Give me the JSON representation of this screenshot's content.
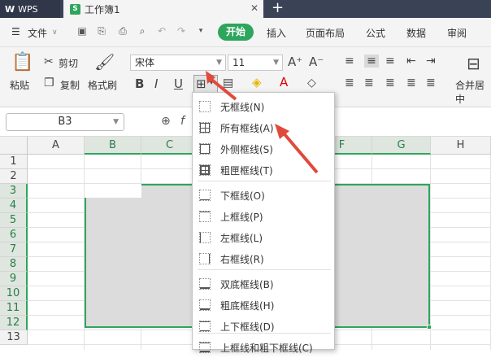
{
  "titlebar": {
    "app_tab": "WPS",
    "doc_tab": "工作簿1",
    "doc_icon": "S"
  },
  "menubar": {
    "file": "文件",
    "tabs": [
      "开始",
      "插入",
      "页面布局",
      "公式",
      "数据",
      "审阅"
    ]
  },
  "ribbon": {
    "paste": "粘贴",
    "cut": "剪切",
    "copy": "复制",
    "format_painter": "格式刷",
    "font_name": "宋体",
    "font_size": "11",
    "merge_center": "合并居中"
  },
  "formula_bar": {
    "name_box": "B3"
  },
  "grid": {
    "columns": [
      "A",
      "B",
      "C",
      "D",
      "E",
      "F",
      "G",
      "H"
    ],
    "rows": [
      "1",
      "2",
      "3",
      "4",
      "5",
      "6",
      "7",
      "8",
      "9",
      "10",
      "11",
      "12",
      "13"
    ]
  },
  "border_menu": {
    "items": [
      "无框线(N)",
      "所有框线(A)",
      "外侧框线(S)",
      "粗匣框线(T)",
      "下框线(O)",
      "上框线(P)",
      "左框线(L)",
      "右框线(R)",
      "双底框线(B)",
      "粗底框线(H)",
      "上下框线(D)",
      "上框线和粗下框线(C)"
    ]
  },
  "colors": {
    "accent": "#2ea55d",
    "arrow": "#e04a3c",
    "titlebar": "#3a4356"
  }
}
